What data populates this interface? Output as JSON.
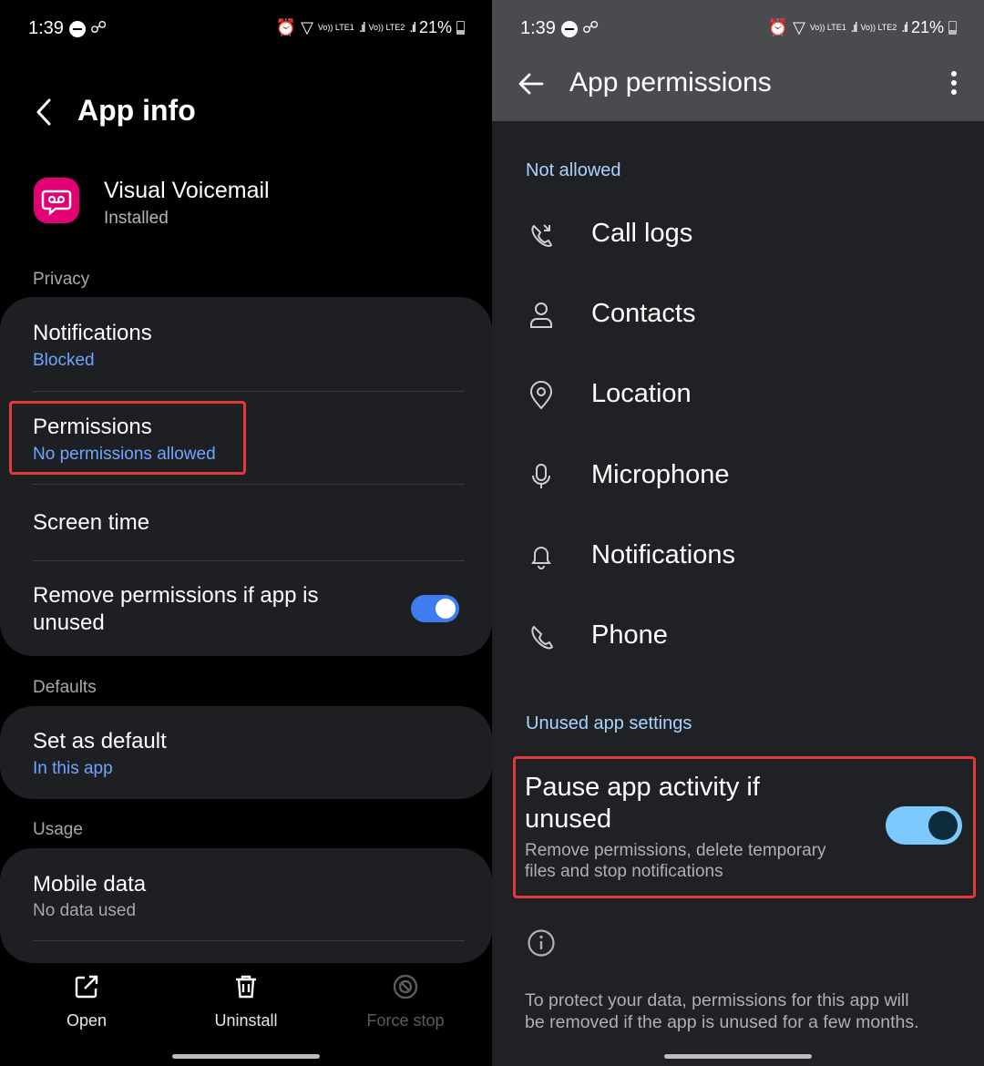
{
  "status_bar": {
    "time": "1:39",
    "network_1": "Vo)) LTE1",
    "network_2": "Vo)) LTE2",
    "battery": "21%"
  },
  "left": {
    "title": "App info",
    "app": {
      "name": "Visual Voicemail",
      "status": "Installed",
      "icon_color": "#e20074"
    },
    "privacy_label": "Privacy",
    "notifications": {
      "title": "Notifications",
      "sub": "Blocked"
    },
    "permissions": {
      "title": "Permissions",
      "sub": "No permissions allowed"
    },
    "screen_time": {
      "title": "Screen time"
    },
    "remove_permissions": {
      "title_line1": "Remove permissions if app is",
      "title_line2": "unused",
      "enabled": true
    },
    "defaults_label": "Defaults",
    "set_default": {
      "title": "Set as default",
      "sub": "In this app"
    },
    "usage_label": "Usage",
    "mobile_data": {
      "title": "Mobile data",
      "sub": "No data used"
    },
    "bottom_actions": {
      "open": "Open",
      "uninstall": "Uninstall",
      "force_stop": "Force stop"
    }
  },
  "right": {
    "title": "App permissions",
    "not_allowed_label": "Not allowed",
    "permissions": [
      "Call logs",
      "Contacts",
      "Location",
      "Microphone",
      "Notifications",
      "Phone"
    ],
    "unused_label": "Unused app settings",
    "pause": {
      "title_line1": "Pause app activity if",
      "title_line2": "unused",
      "sub_line1": "Remove permissions, delete temporary",
      "sub_line2": "files and stop notifications",
      "enabled": true
    },
    "info_line1": "To protect your data, permissions for this app will",
    "info_line2": "be removed if the app is unused for a few months."
  },
  "colors": {
    "accent_blue": "#6ea6ff",
    "highlight_red": "#e5383b",
    "toggle_blue": "#3f7cf0",
    "toggle_light": "#7cc9ff"
  }
}
